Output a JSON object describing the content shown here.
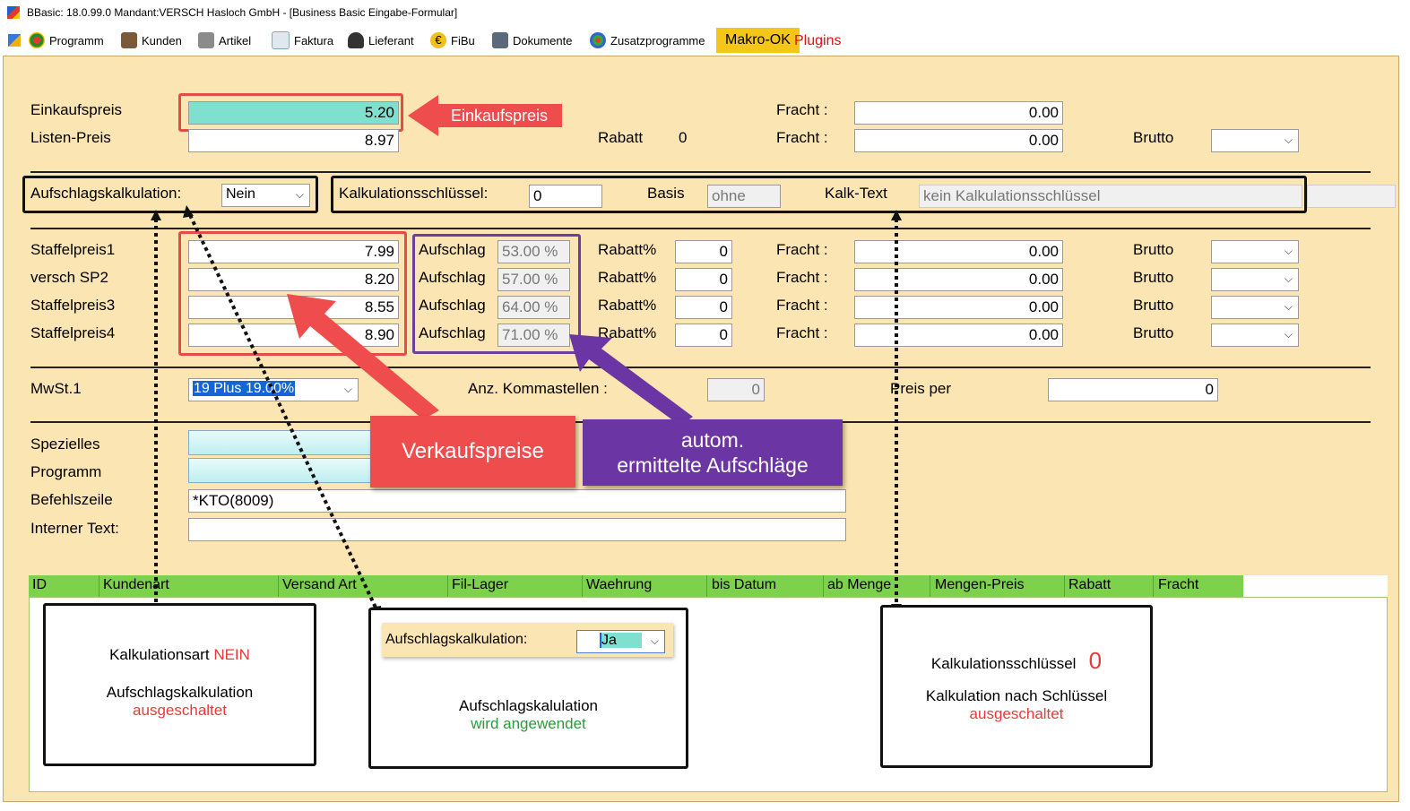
{
  "window": {
    "title": "BBasic: 18.0.99.0 Mandant:VERSCH Hasloch GmbH  - [Business Basic Eingabe-Formular]"
  },
  "menu": {
    "items": [
      "Programm",
      "Kunden",
      "Artikel",
      "Faktura",
      "Lieferant",
      "FiBu",
      "Dokumente",
      "Zusatzprogramme"
    ],
    "makro": "Makro-OK",
    "plugins": "Plugins"
  },
  "form": {
    "einkaufspreis_label": "Einkaufspreis",
    "einkaufspreis_value": "5.20",
    "listenpreis_label": "Listen-Preis",
    "listenpreis_value": "8.97",
    "rabatt_label": "Rabatt",
    "rabatt_value": "0",
    "fracht_label": "Fracht :",
    "fracht1_value": "0.00",
    "fracht2_value": "0.00",
    "brutto_label": "Brutto",
    "aufschlag_kalk_label": "Aufschlagskalkulation:",
    "aufschlag_kalk_value": "Nein",
    "kalk_schluessel_label": "Kalkulationsschlüssel:",
    "kalk_schluessel_value": "0",
    "basis_label": "Basis",
    "basis_value": "ohne",
    "kalk_text_label": "Kalk-Text",
    "kalk_text_value": "kein Kalkulationsschlüssel",
    "staffel": [
      {
        "label": "Staffelpreis1",
        "price": "7.99",
        "aufschlag": "53.00 %",
        "rabatt": "0",
        "fracht": "0.00"
      },
      {
        "label": "versch SP2",
        "price": "8.20",
        "aufschlag": "57.00 %",
        "rabatt": "0",
        "fracht": "0.00"
      },
      {
        "label": "Staffelpreis3",
        "price": "8.55",
        "aufschlag": "64.00 %",
        "rabatt": "0",
        "fracht": "0.00"
      },
      {
        "label": "Staffelpreis4",
        "price": "8.90",
        "aufschlag": "71.00 %",
        "rabatt": "0",
        "fracht": "0.00"
      }
    ],
    "aufschlag_label": "Aufschlag",
    "rabatt_pct_label": "Rabatt%",
    "mwst_label": "MwSt.1",
    "mwst_value": "19 Plus 19.00%",
    "kommastellen_label": "Anz. Kommastellen :",
    "kommastellen_value": "0",
    "preis_per_label": "Preis per",
    "preis_per_value": "0",
    "spezielles_label": "Spezielles",
    "programm_label": "Programm",
    "befehlszeile_label": "Befehlszeile",
    "befehlszeile_value": "*KTO(8009)",
    "interner_text_label": "Interner Text:"
  },
  "grid": {
    "columns": [
      "ID",
      "Kundenart",
      "Versand Art",
      "Fil-Lager",
      "Waehrung",
      "bis Datum",
      "ab Menge",
      "Mengen-Preis",
      "Rabatt",
      "Fracht"
    ]
  },
  "callouts": {
    "einkaufspreis": "Einkaufspreis",
    "verkaufspreise": "Verkaufspreise",
    "aufschlaege_line1": "autom.",
    "aufschlaege_line2": "ermittelte Aufschläge"
  },
  "info_boxes": {
    "left": {
      "line1": "Kalkulationsart",
      "line1_flag": "NEIN",
      "line2": "Aufschlagskalkulation",
      "line3": "ausgeschaltet"
    },
    "middle": {
      "label": "Aufschlagskalkulation:",
      "value": "Ja",
      "line2": "Aufschlagskalulation",
      "line3": "wird angewendet"
    },
    "right": {
      "line1": "Kalkulationsschlüssel",
      "line1_flag": "0",
      "line2": "Kalkulation nach Schlüssel",
      "line3": "ausgeschaltet"
    }
  },
  "colors": {
    "form_bg": "#fbe5b3",
    "highlight_red": "#e84a4a",
    "highlight_purple": "#6a3fa0",
    "grid_header": "#7ed14a"
  }
}
